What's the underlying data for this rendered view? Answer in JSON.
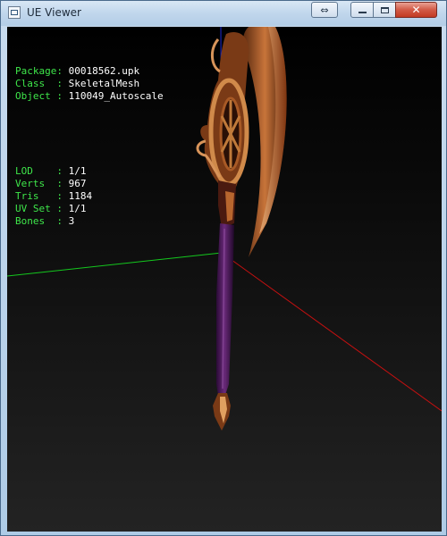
{
  "window": {
    "title": "UE Viewer"
  },
  "caption_buttons": {
    "swap_icon": "double-arrow-icon",
    "minimize_icon": "minimize-icon",
    "maximize_icon": "maximize-icon",
    "close_icon": "close-icon"
  },
  "info_top": [
    {
      "label": "Package:",
      "value": "00018562.upk"
    },
    {
      "label": "Class  :",
      "value": "SkeletalMesh"
    },
    {
      "label": "Object :",
      "value": "110049_Autoscale"
    }
  ],
  "info_stats": [
    {
      "label": "LOD    :",
      "value": "1/1"
    },
    {
      "label": "Verts  :",
      "value": "967"
    },
    {
      "label": "Tris   :",
      "value": "1184"
    },
    {
      "label": "UV Set :",
      "value": "1/1"
    },
    {
      "label": "Bones  :",
      "value": "3"
    }
  ],
  "colors": {
    "label_green": "#3ee64a",
    "axis_x": "#c81010",
    "axis_y": "#14c81e",
    "axis_z": "#1e2ad2",
    "mesh_shaft": "#4a1656",
    "mesh_metal": "#c8743a"
  }
}
